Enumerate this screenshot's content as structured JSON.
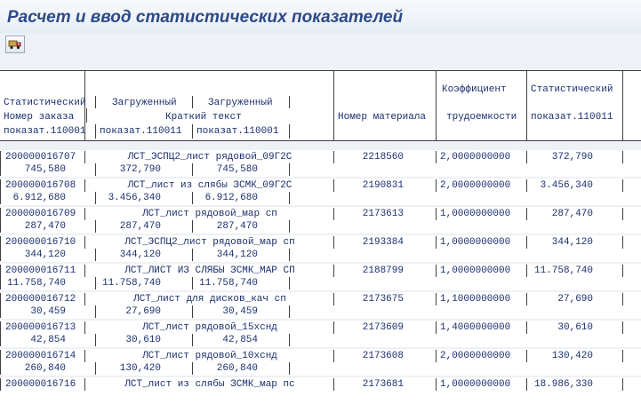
{
  "title": "Расчет и ввод статистических показателей",
  "toolbar": {
    "icon": "truck-icon"
  },
  "header": {
    "stat_label": "Статистический",
    "order_label": "Номер заказа",
    "stat_code_1": "показат.110001",
    "loaded_1": "Загруженный",
    "loaded_2": "Загруженный",
    "short_text": "Краткий текст",
    "loaded_code_1": "показат.110011",
    "loaded_code_2": "показат.110001",
    "material": "Номер материала",
    "coef_label": "Коэффициент",
    "coef_sub": "трудоемкости",
    "stat2_label": "Статистический",
    "stat2_code": "показат.110011"
  },
  "rows": [
    {
      "order": "200000016707",
      "text": "ЛСТ_ЭСПЦ2_лист рядовой_09Г2С",
      "material": "2218560",
      "coef": "2,0000000000",
      "stat": "372,790",
      "a": "745,580",
      "b": "372,790",
      "c": "745,580"
    },
    {
      "order": "200000016708",
      "text": "ЛСТ_лист из слябы ЗСМК_09Г2С",
      "material": "2190831",
      "coef": "2,0000000000",
      "stat": "3.456,340",
      "a": "6.912,680",
      "b": "3.456,340",
      "c": "6.912,680"
    },
    {
      "order": "200000016709",
      "text": "ЛСТ_лист рядовой_мар сп",
      "material": "2173613",
      "coef": "1,0000000000",
      "stat": "287,470",
      "a": "287,470",
      "b": "287,470",
      "c": "287,470"
    },
    {
      "order": "200000016710",
      "text": "ЛСТ_ЭСПЦ2_лист рядовой_мар сп",
      "material": "2193384",
      "coef": "1,0000000000",
      "stat": "344,120",
      "a": "344,120",
      "b": "344,120",
      "c": "344,120"
    },
    {
      "order": "200000016711",
      "text": "ЛСТ_ЛИСТ ИЗ СЛЯБЫ ЗСМК_МАР СП",
      "material": "2188799",
      "coef": "1,0000000000",
      "stat": "11.758,740",
      "a": "11.758,740",
      "b": "11.758,740",
      "c": "11.758,740"
    },
    {
      "order": "200000016712",
      "text": "ЛСТ_лист для дисков_кач сп",
      "material": "2173675",
      "coef": "1,1000000000",
      "stat": "27,690",
      "a": "30,459",
      "b": "27,690",
      "c": "30,459"
    },
    {
      "order": "200000016713",
      "text": "ЛСТ_лист рядовой_15хснд",
      "material": "2173609",
      "coef": "1,4000000000",
      "stat": "30,610",
      "a": "42,854",
      "b": "30,610",
      "c": "42,854"
    },
    {
      "order": "200000016714",
      "text": "ЛСТ_лист рядовой_10хснд",
      "material": "2173608",
      "coef": "2,0000000000",
      "stat": "130,420",
      "a": "260,840",
      "b": "130,420",
      "c": "260,840"
    },
    {
      "order": "200000016716",
      "text": "ЛСТ_лист из слябы ЗСМК_мар пс",
      "material": "2173681",
      "coef": "1,0000000000",
      "stat": "18.986,330",
      "a": "",
      "b": "",
      "c": ""
    }
  ]
}
